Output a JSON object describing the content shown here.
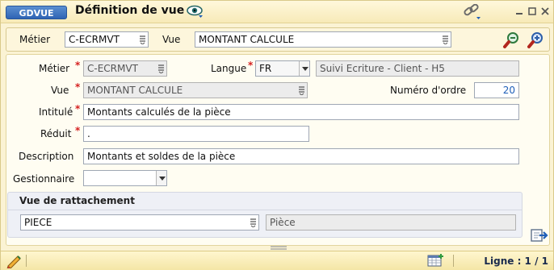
{
  "window": {
    "badge": "GDVUE",
    "title": "Définition de vue"
  },
  "toolbar": {
    "metier_label": "Métier",
    "metier_value": "C-ECRMVT",
    "vue_label": "Vue",
    "vue_value": "MONTANT CALCULE"
  },
  "form": {
    "metier": {
      "label": "Métier",
      "value": "C-ECRMVT",
      "required": "*"
    },
    "langue": {
      "label": "Langue",
      "value": "FR",
      "required": "*",
      "description": "Suivi Ecriture - Client - H5"
    },
    "vue": {
      "label": "Vue",
      "value": "MONTANT CALCULE",
      "required": "*"
    },
    "ordre": {
      "label": "Numéro d'ordre",
      "value": "20"
    },
    "intitule": {
      "label": "Intitulé",
      "value": "Montants calculés  de la pièce",
      "required": "*"
    },
    "reduit": {
      "label": "Réduit",
      "value": ".",
      "required": "*"
    },
    "description": {
      "label": "Description",
      "value": "Montants et soldes de la pièce"
    },
    "gestionnaire": {
      "label": "Gestionnaire",
      "value": ""
    }
  },
  "rattachement": {
    "title": "Vue de rattachement",
    "value": "PIECE",
    "description": "Pièce"
  },
  "status": {
    "line": "Ligne : 1 / 1"
  },
  "icons": {
    "title_eye": "eye-icon",
    "title_link": "link-icon",
    "search_minus": "search-remove-icon",
    "search_plus": "search-add-icon",
    "export": "export-arrow-icon",
    "pencil": "pencil-icon",
    "grid_add": "grid-add-icon"
  },
  "colors": {
    "badge": "#2e64b4",
    "required": "#d52020",
    "window_bg": "#fbf3d4",
    "accent_blue": "#1f5fb8"
  }
}
